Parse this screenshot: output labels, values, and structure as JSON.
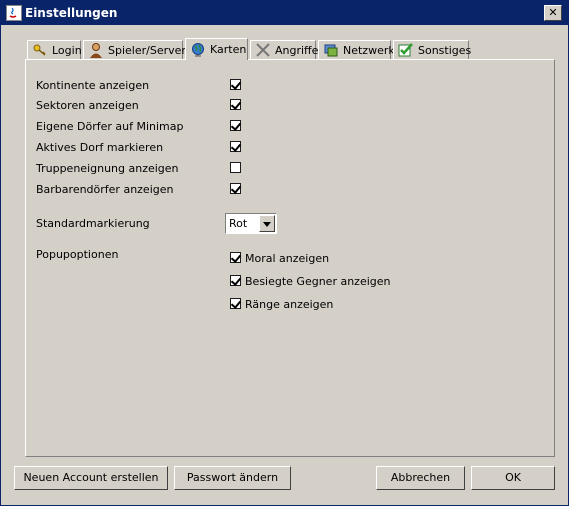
{
  "window": {
    "title": "Einstellungen",
    "close_label": "✕"
  },
  "tabs": [
    {
      "label": "Login",
      "icon": "key-icon"
    },
    {
      "label": "Spieler/Server",
      "icon": "player-icon"
    },
    {
      "label": "Karten",
      "icon": "globe-icon",
      "active": true
    },
    {
      "label": "Angriffe",
      "icon": "swords-icon"
    },
    {
      "label": "Netzwerk",
      "icon": "network-icon"
    },
    {
      "label": "Sonstiges",
      "icon": "checkmark-icon"
    }
  ],
  "options": [
    {
      "label": "Kontinente anzeigen",
      "checked": true
    },
    {
      "label": "Sektoren anzeigen",
      "checked": true
    },
    {
      "label": "Eigene Dörfer auf Minimap",
      "checked": true
    },
    {
      "label": "Aktives Dorf markieren",
      "checked": true
    },
    {
      "label": "Truppeneignung anzeigen",
      "checked": false
    },
    {
      "label": "Barbarendörfer anzeigen",
      "checked": true
    }
  ],
  "standard_marking": {
    "label": "Standardmarkierung",
    "value": "Rot"
  },
  "popup": {
    "label": "Popupoptionen",
    "options": [
      {
        "label": "Moral anzeigen",
        "checked": true
      },
      {
        "label": "Besiegte Gegner anzeigen",
        "checked": true
      },
      {
        "label": "Ränge anzeigen",
        "checked": true
      }
    ]
  },
  "buttons": {
    "new_account": "Neuen Account erstellen",
    "change_password": "Passwort ändern",
    "cancel": "Abbrechen",
    "ok": "OK"
  }
}
